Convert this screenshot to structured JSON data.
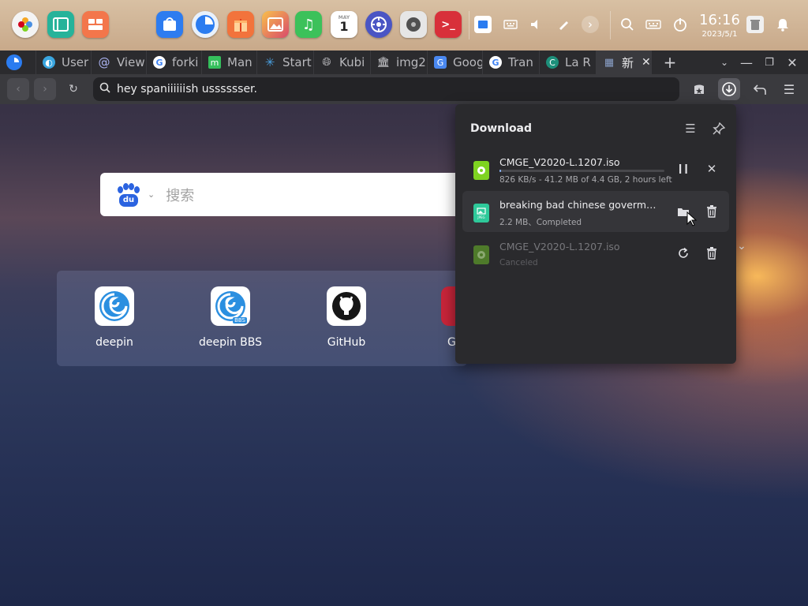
{
  "dock": {
    "apps": [
      {
        "name": "launcher-icon",
        "glyph": "✿",
        "color": "#f4f4f4"
      },
      {
        "name": "multitask-view-icon",
        "glyph": "▤",
        "color": "#26b39a"
      },
      {
        "name": "control-center-icon",
        "glyph": "▦",
        "color": "#f3764b"
      },
      {
        "name": "app-store-icon",
        "glyph": "⛁",
        "color": "#2d7cf0"
      },
      {
        "name": "browser-icon",
        "glyph": "◐",
        "color": "#ffffff"
      },
      {
        "name": "gift-app-icon",
        "glyph": "▥",
        "color": "#f2733c"
      },
      {
        "name": "photos-icon",
        "glyph": "▣",
        "color": "#e8643f"
      },
      {
        "name": "music-icon",
        "glyph": "♫",
        "color": "#3cc15a"
      },
      {
        "name": "calendar-icon",
        "glyph": "1",
        "color": "#ffffff"
      },
      {
        "name": "system-monitor-icon",
        "glyph": "⚙",
        "color": "#4a55c4"
      },
      {
        "name": "disk-utility-icon",
        "glyph": "◉",
        "color": "#707070"
      },
      {
        "name": "terminal-icon",
        "glyph": ">_",
        "color": "#d8303a"
      }
    ],
    "clock": {
      "time": "16:16",
      "date": "2023/5/1"
    },
    "calendar_badge": "1"
  },
  "tabs": [
    {
      "label": "",
      "icon": "browser-logo-icon",
      "color": "#2b7cf0"
    },
    {
      "label": "User",
      "icon": "deepin-logo-icon",
      "color": "#3aa6e0"
    },
    {
      "label": "View",
      "icon": "at-sign-icon",
      "color": "#5a6ad8"
    },
    {
      "label": "forki",
      "icon": "google-icon",
      "color": "#ffffff"
    },
    {
      "label": "Man",
      "icon": "manjaro-icon",
      "color": "#35bf5c"
    },
    {
      "label": "Start",
      "icon": "star-icon",
      "color": "#4aa0e0"
    },
    {
      "label": "Kubi",
      "icon": "globe-icon",
      "color": "#9a9aa0"
    },
    {
      "label": "img2",
      "icon": "museum-icon",
      "color": "#c0c0c4"
    },
    {
      "label": "Goog",
      "icon": "google-translate-icon",
      "color": "#4a88f0"
    },
    {
      "label": "Tran",
      "icon": "google-icon",
      "color": "#ffffff"
    },
    {
      "label": "La R",
      "icon": "c-logo-icon",
      "color": "#1d8f7a"
    },
    {
      "label": "新",
      "icon": "grid-icon",
      "color": "#8aa0c8"
    }
  ],
  "urlbar": {
    "value": "hey spaniiiiiish usssssser."
  },
  "newtab": {
    "search_placeholder": "搜索",
    "baidu_label": "du",
    "shortcuts": [
      {
        "label": "deepin"
      },
      {
        "label": "deepin BBS",
        "badge": "BBS"
      },
      {
        "label": "GitHub"
      },
      {
        "label": "G"
      }
    ]
  },
  "download": {
    "title": "Download",
    "items": [
      {
        "name": "CMGE_V2020-L.1207.iso",
        "meta": "826 KB/s - 41.2 MB of 4.4 GB, 2 hours left",
        "progress_fraction": 0.0094,
        "state": "downloading",
        "file_color": "#7ed321"
      },
      {
        "name": "breaking bad chinese goverment e...",
        "meta": "2.2 MB、Completed",
        "state": "completed",
        "file_color": "#2ec99a",
        "file_label": "JPEG"
      },
      {
        "name": "CMGE_V2020-L.1207.iso",
        "meta": "Canceled",
        "state": "canceled",
        "file_color": "#4e7a2a"
      }
    ]
  }
}
